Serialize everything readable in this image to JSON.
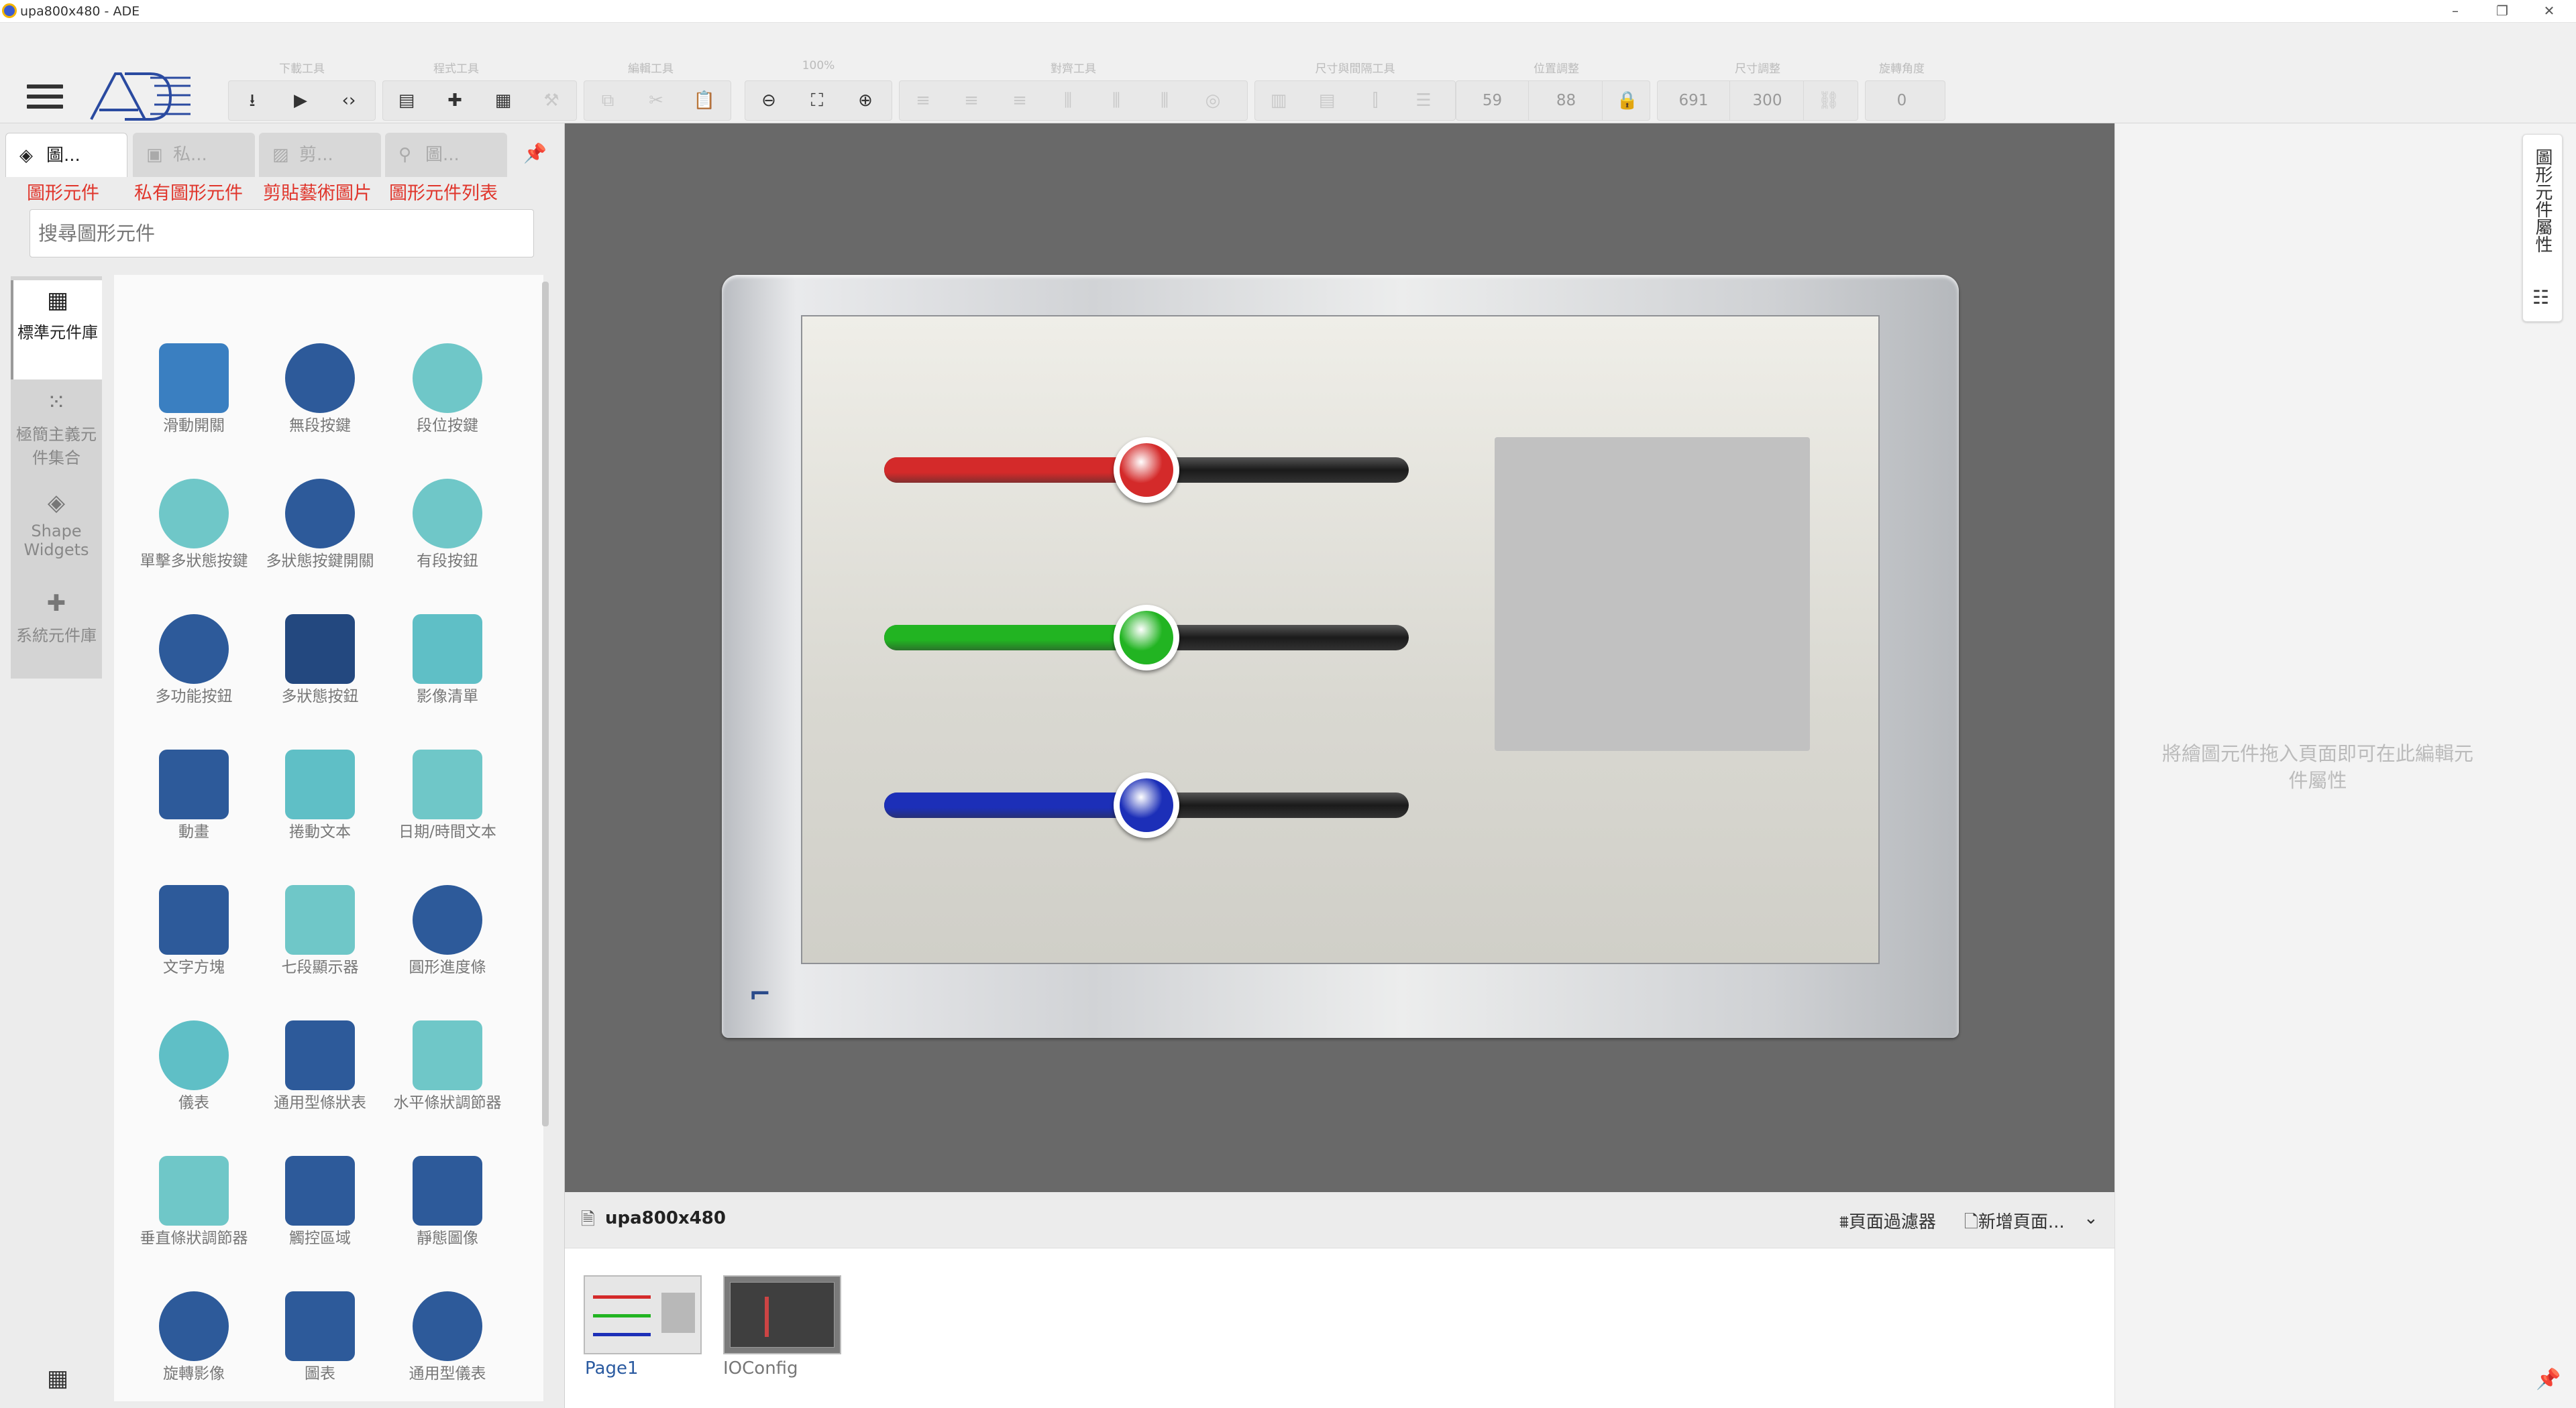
{
  "window": {
    "title": "upa800x480 - ADE",
    "min": "–",
    "restore": "❐",
    "close": "✕"
  },
  "toolbar": {
    "group_labels": [
      "下載工具",
      "程式工具",
      "編輯工具",
      "100%",
      "對齊工具",
      "尺寸與間隔工具",
      "位置調整",
      "尺寸調整",
      "旋轉角度"
    ],
    "position": {
      "x": "59",
      "y": "88"
    },
    "size": {
      "w": "691",
      "h": "300"
    },
    "rotation": "0"
  },
  "left_panel": {
    "tabs": [
      {
        "label": "圖...",
        "icon": "layers-icon"
      },
      {
        "label": "私...",
        "icon": "briefcase-icon"
      },
      {
        "label": "剪...",
        "icon": "image-icon"
      },
      {
        "label": "圖...",
        "icon": "location-pin-icon"
      }
    ],
    "tab_captions": [
      "圖形元件",
      "私有圖形元件",
      "剪貼藝術圖片",
      "圖形元件列表"
    ],
    "search_placeholder": "搜尋圖形元件",
    "categories": [
      {
        "label": "標準元件庫",
        "icon": "widget-library-icon"
      },
      {
        "label": "極簡主義元件集合",
        "icon": "grid-dots-icon"
      },
      {
        "label": "Shape Widgets",
        "icon": "layers-icon"
      },
      {
        "label": "系統元件庫",
        "icon": "puzzle-icon"
      }
    ],
    "widgets": [
      {
        "label": "滑動開關",
        "icon": "slide-switch-icon",
        "color": "#3a7fc1"
      },
      {
        "label": "無段按鍵",
        "icon": "stepless-button-icon",
        "color": "#2d5a9a"
      },
      {
        "label": "段位按鍵",
        "icon": "step-button-icon",
        "color": "#6fc7c8"
      },
      {
        "label": "單擊多狀態按鍵",
        "icon": "multi-state-button-icon",
        "color": "#6fc7c8"
      },
      {
        "label": "多狀態按鍵開關",
        "icon": "multi-state-switch-icon",
        "color": "#2d5a9a"
      },
      {
        "label": "有段按鈕",
        "icon": "segmented-button-icon",
        "color": "#6fc7c8"
      },
      {
        "label": "多功能按鈕",
        "icon": "multifunction-button-icon",
        "color": "#2d5a9a"
      },
      {
        "label": "多狀態按鈕",
        "icon": "multi-state-image-icon",
        "color": "#23487f"
      },
      {
        "label": "影像清單",
        "icon": "image-list-icon",
        "color": "#5fbfc6"
      },
      {
        "label": "動畫",
        "icon": "animation-icon",
        "color": "#2d5a9a"
      },
      {
        "label": "捲動文本",
        "icon": "scrolling-text-icon",
        "color": "#5fbfc6"
      },
      {
        "label": "日期/時間文本",
        "icon": "datetime-icon",
        "color": "#6fc7c8"
      },
      {
        "label": "文字方塊",
        "icon": "text-box-icon",
        "color": "#2d5a9a"
      },
      {
        "label": "七段顯示器",
        "icon": "seven-segment-icon",
        "color": "#6fc7c8"
      },
      {
        "label": "圓形進度條",
        "icon": "circular-progress-icon",
        "color": "#2d5a9a"
      },
      {
        "label": "儀表",
        "icon": "gauge-icon",
        "color": "#5fbfc6"
      },
      {
        "label": "通用型條狀表",
        "icon": "bar-meter-icon",
        "color": "#2d5a9a"
      },
      {
        "label": "水平條狀調節器",
        "icon": "horizontal-slider-icon",
        "color": "#6fc7c8"
      },
      {
        "label": "垂直條狀調節器",
        "icon": "vertical-slider-icon",
        "color": "#6fc7c8"
      },
      {
        "label": "觸控區域",
        "icon": "touch-area-icon",
        "color": "#2d5a9a"
      },
      {
        "label": "靜態圖像",
        "icon": "static-image-icon",
        "color": "#2d5a9a"
      },
      {
        "label": "旋轉影像",
        "icon": "rotate-image-icon",
        "color": "#2d5a9a"
      },
      {
        "label": "圖表",
        "icon": "chart-icon",
        "color": "#2d5a9a"
      },
      {
        "label": "通用型儀表",
        "icon": "universal-gauge-icon",
        "color": "#2d5a9a"
      }
    ]
  },
  "canvas": {
    "sliders": [
      {
        "color": "#d42a2a",
        "value": 0.5
      },
      {
        "color": "#22b422",
        "value": 0.5
      },
      {
        "color": "#1c2fb8",
        "value": 0.5
      }
    ]
  },
  "right_panel": {
    "tab_label": "圖形元件屬性",
    "hint": "將繪圖元件拖入頁面即可在此編輯元件屬性"
  },
  "pages": {
    "current": "upa800x480",
    "filter_label": "頁面過濾器",
    "new_page_label": "新增頁面...",
    "list": [
      {
        "label": "Page1"
      },
      {
        "label": "IOConfig"
      }
    ]
  }
}
